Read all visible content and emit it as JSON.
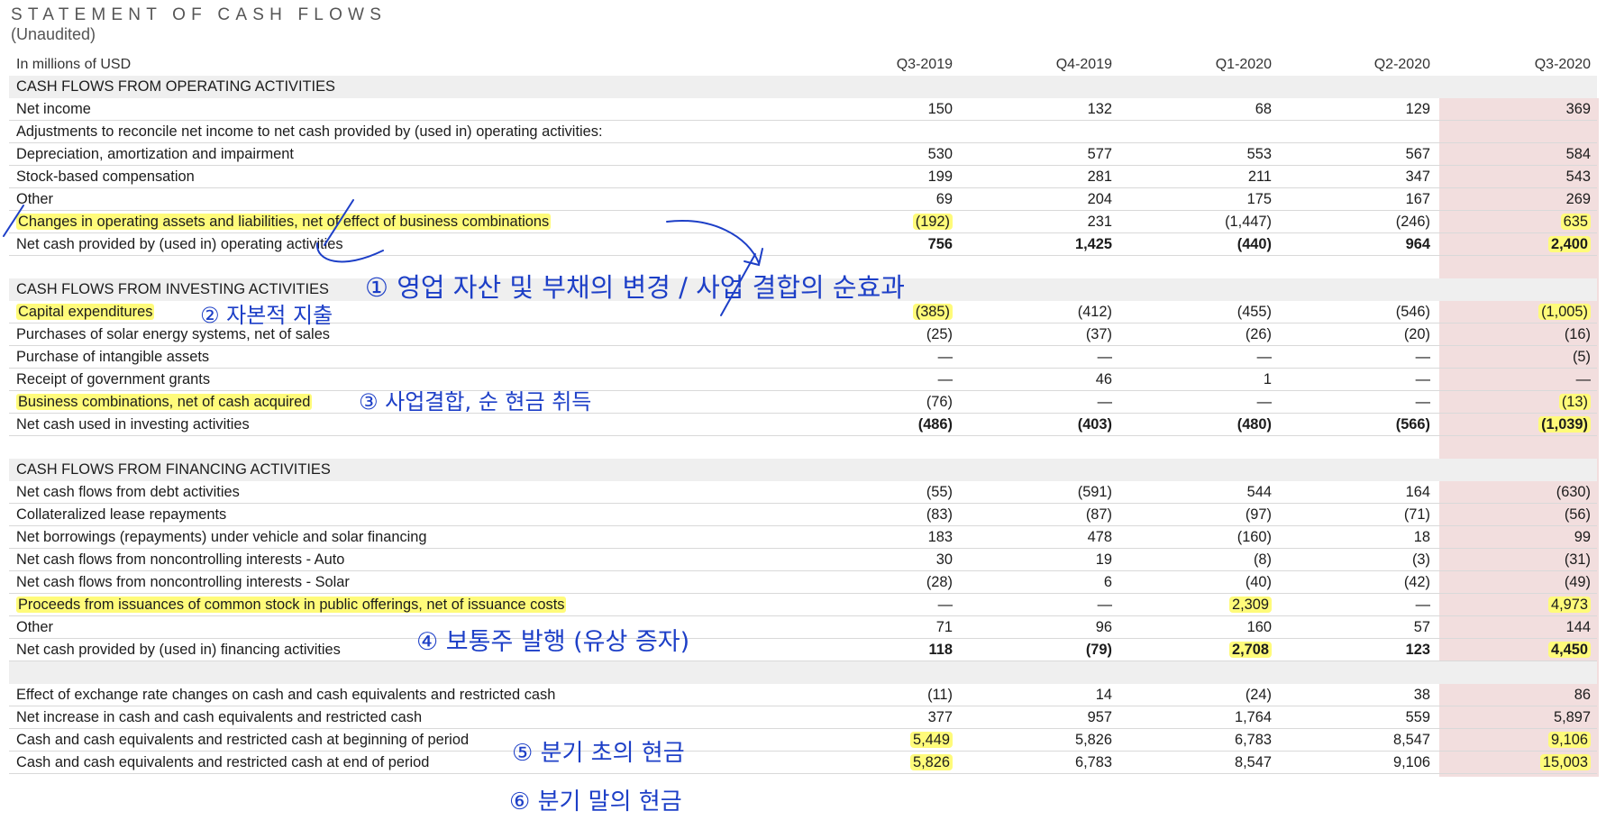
{
  "document": {
    "title": "STATEMENT OF CASH FLOWS",
    "subtitle": "(Unaudited)",
    "units_label": "In millions of USD",
    "periods": [
      "Q3-2019",
      "Q4-2019",
      "Q1-2020",
      "Q2-2020",
      "Q3-2020"
    ],
    "highlight_color": "#fffb7a",
    "current_period_fill": "#f2dede",
    "ink_color": "#1d3fc7"
  },
  "sections": {
    "operating": {
      "header": "CASH FLOWS FROM OPERATING ACTIVITIES",
      "rows": [
        {
          "label": "Net income",
          "values": [
            "150",
            "132",
            "68",
            "129",
            "369"
          ]
        },
        {
          "label": "Adjustments to reconcile net income to net cash provided by (used in) operating activities:",
          "values": [
            "",
            "",
            "",
            "",
            ""
          ]
        },
        {
          "label": "Depreciation, amortization and impairment",
          "values": [
            "530",
            "577",
            "553",
            "567",
            "584"
          ]
        },
        {
          "label": "Stock-based compensation",
          "values": [
            "199",
            "281",
            "211",
            "347",
            "543"
          ]
        },
        {
          "label": "Other",
          "values": [
            "69",
            "204",
            "175",
            "167",
            "269"
          ]
        },
        {
          "label": "Changes in operating assets and liabilities, net of effect of business combinations",
          "values": [
            "(192)",
            "231",
            "(1,447)",
            "(246)",
            "635"
          ]
        },
        {
          "label": "Net cash provided by (used in) operating activities",
          "values": [
            "756",
            "1,425",
            "(440)",
            "964",
            "2,400"
          ]
        }
      ]
    },
    "investing": {
      "header": "CASH FLOWS FROM INVESTING ACTIVITIES",
      "rows": [
        {
          "label": "Capital expenditures",
          "values": [
            "(385)",
            "(412)",
            "(455)",
            "(546)",
            "(1,005)"
          ]
        },
        {
          "label": "Purchases of solar energy systems, net of sales",
          "values": [
            "(25)",
            "(37)",
            "(26)",
            "(20)",
            "(16)"
          ]
        },
        {
          "label": "Purchase of intangible assets",
          "values": [
            "—",
            "—",
            "—",
            "—",
            "(5)"
          ]
        },
        {
          "label": "Receipt of government grants",
          "values": [
            "—",
            "46",
            "1",
            "—",
            "—"
          ]
        },
        {
          "label": "Business combinations, net of cash acquired",
          "values": [
            "(76)",
            "—",
            "—",
            "—",
            "(13)"
          ]
        },
        {
          "label": "Net cash used in investing activities",
          "values": [
            "(486)",
            "(403)",
            "(480)",
            "(566)",
            "(1,039)"
          ]
        }
      ]
    },
    "financing": {
      "header": "CASH FLOWS FROM FINANCING ACTIVITIES",
      "rows": [
        {
          "label": "Net cash flows from debt activities",
          "values": [
            "(55)",
            "(591)",
            "544",
            "164",
            "(630)"
          ]
        },
        {
          "label": "Collateralized lease repayments",
          "values": [
            "(83)",
            "(87)",
            "(97)",
            "(71)",
            "(56)"
          ]
        },
        {
          "label": "Net borrowings (repayments) under vehicle and solar financing",
          "values": [
            "183",
            "478",
            "(160)",
            "18",
            "99"
          ]
        },
        {
          "label": "Net cash flows from noncontrolling interests - Auto",
          "values": [
            "30",
            "19",
            "(8)",
            "(3)",
            "(31)"
          ]
        },
        {
          "label": "Net cash flows from noncontrolling interests - Solar",
          "values": [
            "(28)",
            "6",
            "(40)",
            "(42)",
            "(49)"
          ]
        },
        {
          "label": "Proceeds from issuances of common stock in public offerings, net of issuance costs",
          "values": [
            "—",
            "—",
            "2,309",
            "—",
            "4,973"
          ]
        },
        {
          "label": "Other",
          "values": [
            "71",
            "96",
            "160",
            "57",
            "144"
          ]
        },
        {
          "label": "Net cash provided by (used in) financing activities",
          "values": [
            "118",
            "(79)",
            "2,708",
            "123",
            "4,450"
          ]
        }
      ]
    },
    "summary": {
      "rows": [
        {
          "label": "Effect of exchange rate changes on cash and cash equivalents and restricted cash",
          "values": [
            "(11)",
            "14",
            "(24)",
            "38",
            "86"
          ]
        },
        {
          "label": "Net increase in cash and cash equivalents and restricted cash",
          "values": [
            "377",
            "957",
            "1,764",
            "559",
            "5,897"
          ]
        },
        {
          "label": "Cash and cash equivalents and restricted cash at beginning of period",
          "values": [
            "5,449",
            "5,826",
            "6,783",
            "8,547",
            "9,106"
          ]
        },
        {
          "label": "Cash and cash equivalents and restricted cash at end of period",
          "values": [
            "5,826",
            "6,783",
            "8,547",
            "9,106",
            "15,003"
          ]
        }
      ]
    }
  },
  "annotations": {
    "note1": "① 영업 자산 및 부채의 변경 / 사업 결합의 순효과",
    "note2": "② 자본적 지출",
    "note3": "③ 사업결합, 순 현금 취득",
    "note4": "④ 보통주 발행 (유상 증자)",
    "note5": "⑤ 분기 초의 현금",
    "note6": "⑥ 분기 말의 현금"
  }
}
